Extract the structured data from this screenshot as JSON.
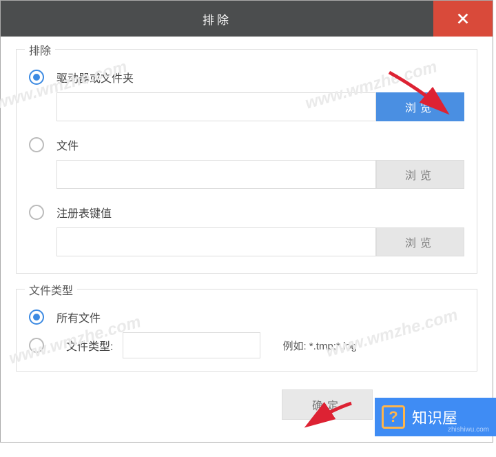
{
  "dialog": {
    "title": "排除"
  },
  "groups": {
    "exclude": {
      "title": "排除",
      "options": {
        "drive_or_folder": {
          "label": "驱动器或文件夹",
          "browse": "浏览"
        },
        "file": {
          "label": "文件",
          "browse": "浏览"
        },
        "registry": {
          "label": "注册表键值",
          "browse": "浏览"
        }
      }
    },
    "filetype": {
      "title": "文件类型",
      "options": {
        "all_files": {
          "label": "所有文件"
        },
        "file_type": {
          "label": "文件类型:",
          "hint": "例如: *.tmp;*.log"
        }
      }
    }
  },
  "footer": {
    "confirm": "确定"
  },
  "badge": {
    "name": "知识屋",
    "url": "zhishiwu.com",
    "q": "?"
  },
  "watermark": "www.wmzhe.com"
}
